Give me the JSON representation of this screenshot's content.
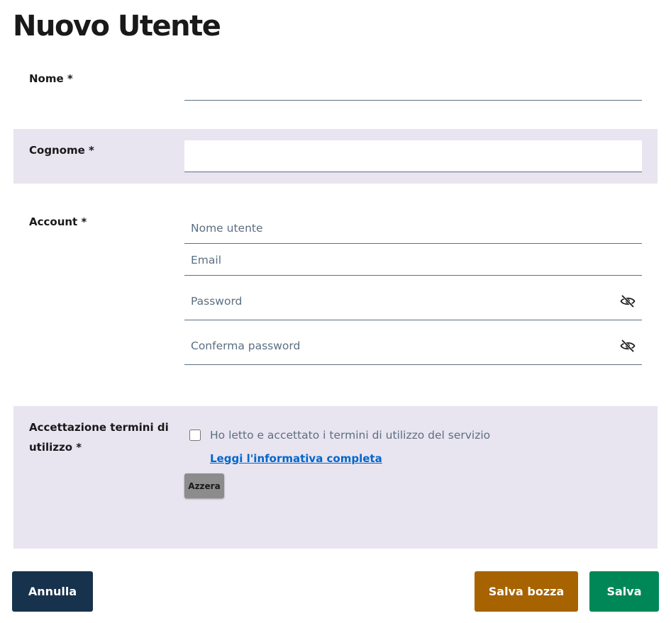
{
  "page": {
    "title": "Nuovo Utente"
  },
  "form": {
    "nome": {
      "label": "Nome *",
      "value": ""
    },
    "cognome": {
      "label": "Cognome *",
      "value": ""
    },
    "account": {
      "label": "Account *",
      "username_placeholder": "Nome utente",
      "email_placeholder": "Email",
      "password_placeholder": "Password",
      "confirm_password_placeholder": "Conferma password",
      "password_toggle_icon": "eye-slash-icon"
    },
    "terms": {
      "label": "Accettazione termini di utilizzo *",
      "checkbox_text": "Ho letto e accettato i termini di utilizzo del servizio",
      "checked": false,
      "link_text": "Leggi l'informativa completa",
      "reset_label": "Azzera"
    }
  },
  "actions": {
    "cancel_label": "Annulla",
    "draft_label": "Salva bozza",
    "save_label": "Salva"
  },
  "colors": {
    "row_shade": "#e8e4f0",
    "cancel_button": "#17324d",
    "draft_button": "#a66300",
    "save_button": "#008758",
    "link": "#0066cc",
    "reset_button": "#8c8c8c",
    "field_border": "#5c6f82"
  }
}
